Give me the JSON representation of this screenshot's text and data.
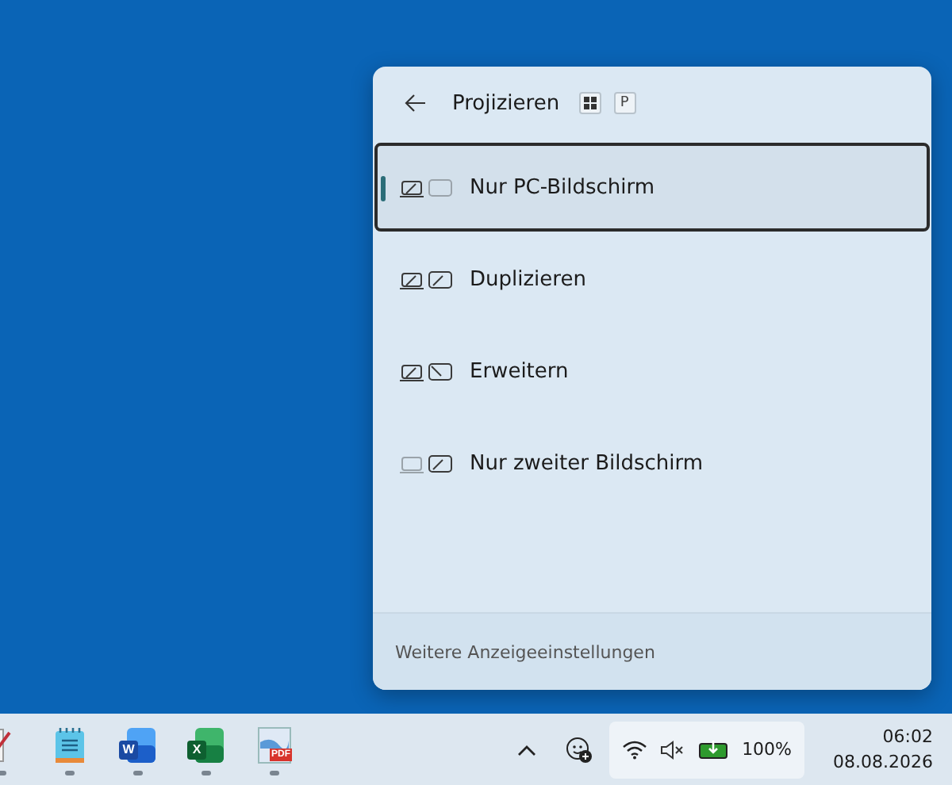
{
  "header": {
    "title": "Projizieren",
    "shortcut_key": "P"
  },
  "options": [
    {
      "label": "Nur PC-Bildschirm",
      "kind": "pc_only",
      "selected": true
    },
    {
      "label": "Duplizieren",
      "kind": "duplicate",
      "selected": false
    },
    {
      "label": "Erweitern",
      "kind": "extend",
      "selected": false
    },
    {
      "label": "Nur zweiter Bildschirm",
      "kind": "second_only",
      "selected": false
    }
  ],
  "footer_link": "Weitere Anzeigeeinstellungen",
  "taskbar": {
    "apps": [
      {
        "kind": "partial"
      },
      {
        "kind": "notepad"
      },
      {
        "kind": "word",
        "letter": "W"
      },
      {
        "kind": "excel",
        "letter": "X"
      },
      {
        "kind": "pdf",
        "letter": "PDF"
      }
    ],
    "battery": "100%",
    "time": "06:02",
    "date": "08.08.2026"
  }
}
